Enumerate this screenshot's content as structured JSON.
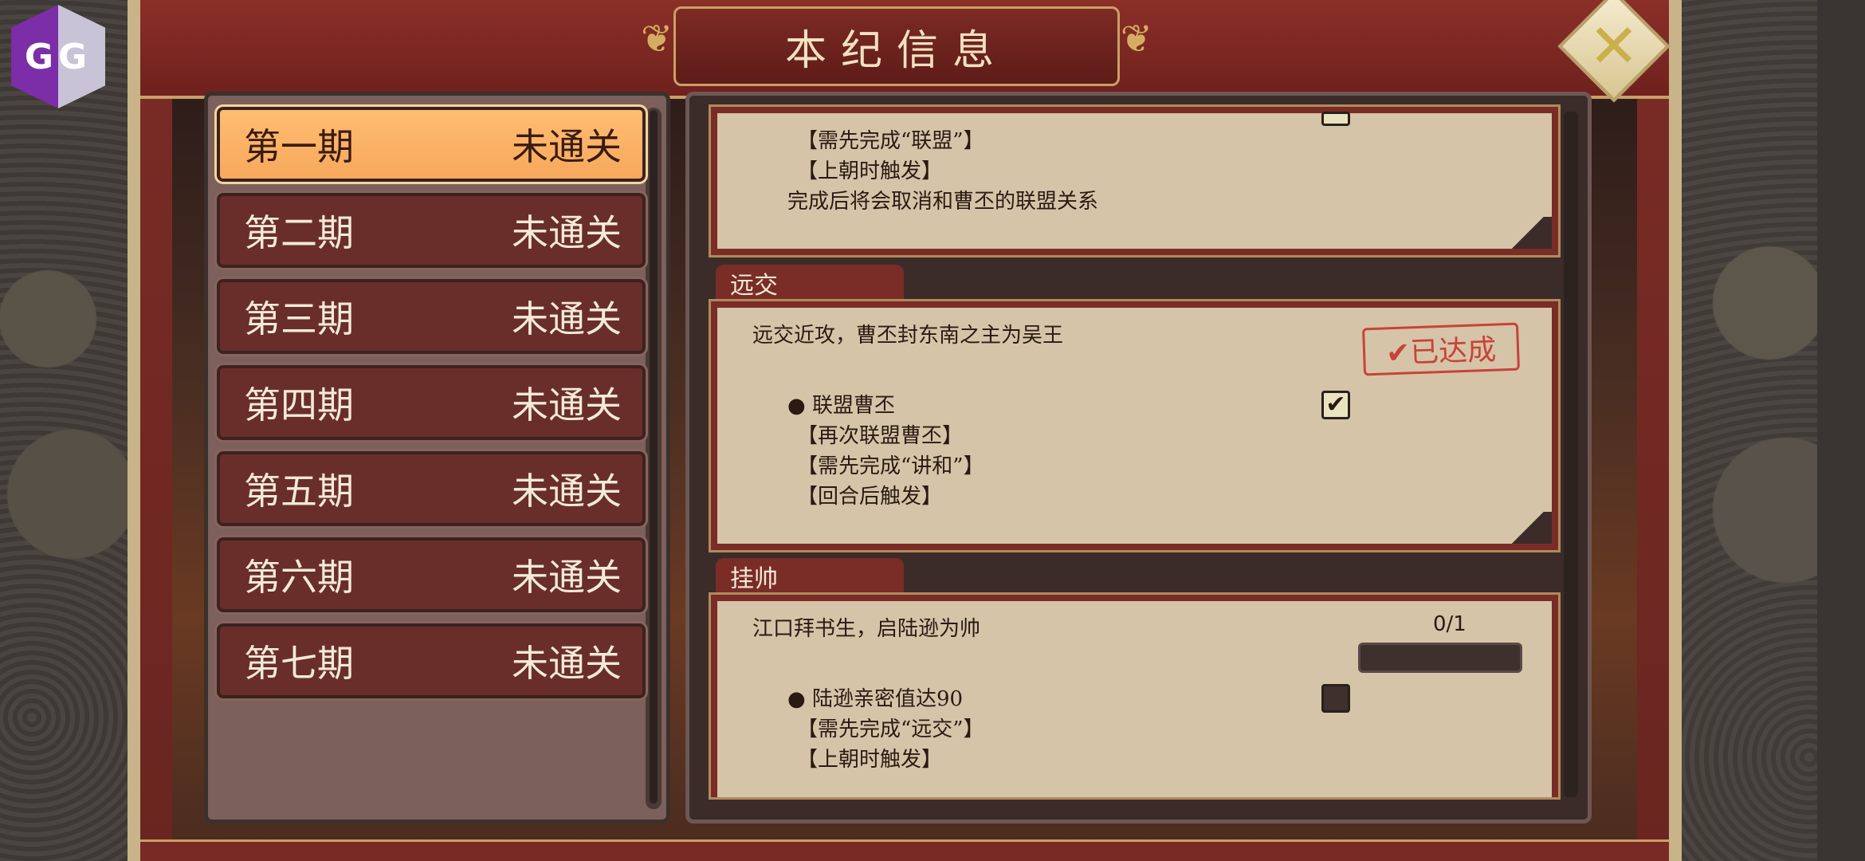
{
  "app": {
    "title": "本纪信息",
    "overlay_logo": "GG"
  },
  "close_icon": "close-x-icon",
  "periods": [
    {
      "name": "第一期",
      "status": "未通关",
      "selected": true
    },
    {
      "name": "第二期",
      "status": "未通关",
      "selected": false
    },
    {
      "name": "第三期",
      "status": "未通关",
      "selected": false
    },
    {
      "name": "第四期",
      "status": "未通关",
      "selected": false
    },
    {
      "name": "第五期",
      "status": "未通关",
      "selected": false
    },
    {
      "name": "第六期",
      "status": "未通关",
      "selected": false
    },
    {
      "name": "第七期",
      "status": "未通关",
      "selected": false
    }
  ],
  "missions": {
    "partial": {
      "lines": [
        "【需先完成“联盟”】",
        "【上朝时触发】"
      ],
      "effect": "完成后将会取消和曹丕的联盟关系",
      "checked": true
    },
    "yuanjiao": {
      "tab": "远交",
      "description": "远交近攻，曹丕封东南之主为吴王",
      "stamp": "✔已达成",
      "condition": "● 联盟曹丕",
      "lines": [
        "【再次联盟曹丕】",
        "【需先完成“讲和”】",
        "【回合后触发】"
      ],
      "checked": true
    },
    "guashuai": {
      "tab": "挂帅",
      "description": "江口拜书生，启陆逊为帅",
      "progress_text": "0/1",
      "progress_value": 0,
      "condition": "● 陆逊亲密值达90",
      "lines": [
        "【需先完成“远交”】",
        "【上朝时触发】"
      ],
      "checked": false
    }
  },
  "colors": {
    "frame_red": "#7a2c26",
    "parchment": "#d5c4a8",
    "selected_tab": "#f7a85c",
    "stamp_red": "#c8433a"
  }
}
